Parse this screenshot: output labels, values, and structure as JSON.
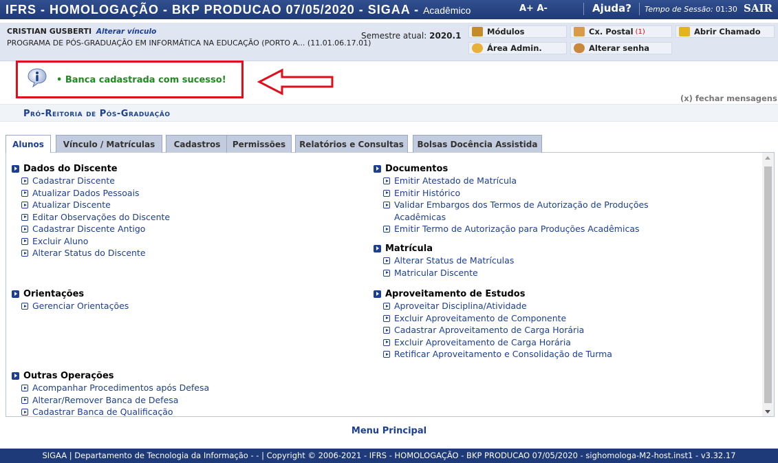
{
  "header": {
    "system_title": "IFRS - HOMOLOGAÇÃO - BKP PRODUCAO 07/05/2020 - SIGAA -",
    "module": "Acadêmico",
    "font_controls": "A+ A-",
    "help": "Ajuda?",
    "session_label": "Tempo de Sessão:",
    "session_time": "01:30",
    "logout": "SAIR"
  },
  "user": {
    "name": "CRISTIAN GUSBERTI",
    "change_link": "Alterar vínculo",
    "program": "PROGRAMA DE PÓS-GRADUAÇÃO EM INFORMÁTICA NA EDUCAÇÃO (PORTO A... (11.01.06.17.01)",
    "semester_label": "Semestre atual:",
    "semester": "2020.1"
  },
  "quick_links": {
    "modules": "Módulos",
    "postal": "Cx. Postal",
    "postal_count": "(1)",
    "ticket": "Abrir Chamado",
    "admin": "Área Admin.",
    "password": "Alterar senha"
  },
  "message": {
    "text": "• Banca cadastrada com sucesso!",
    "close": "(x) fechar mensagens"
  },
  "section_title": "Pró-Reitoria de Pós-Graduação",
  "tabs": [
    "Alunos",
    "Vínculo / Matrículas",
    "Cadastros",
    "Permissões",
    "Relatórios e Consultas",
    "Bolsas Docência Assistida"
  ],
  "groups": {
    "dados": {
      "title": "Dados do Discente",
      "items": [
        "Cadastrar Discente",
        "Atualizar Dados Pessoais",
        "Atualizar Discente",
        "Editar Observações do Discente",
        "Cadastrar Discente Antigo",
        "Excluir Aluno",
        "Alterar Status do Discente"
      ]
    },
    "orientacoes": {
      "title": "Orientações",
      "items": [
        "Gerenciar Orientações"
      ]
    },
    "outras": {
      "title": "Outras Operações",
      "items": [
        "Acompanhar Procedimentos após Defesa",
        "Alterar/Remover Banca de Defesa",
        "Cadastrar Banca de Qualificação"
      ]
    },
    "documentos": {
      "title": "Documentos",
      "items": [
        "Emitir Atestado de Matrícula",
        "Emitir Histórico",
        "Validar Embargos dos Termos de Autorização de Produções Acadêmicas",
        "Emitir Termo de Autorização para Produções Acadêmicas"
      ]
    },
    "matricula": {
      "title": "Matrícula",
      "items": [
        "Alterar Status de Matrículas",
        "Matricular Discente"
      ]
    },
    "aproveitamento": {
      "title": "Aproveitamento de Estudos",
      "items": [
        "Aproveitar Disciplina/Atividade",
        "Excluir Aproveitamento de Componente",
        "Cadastrar Aproveitamento de Carga Horária",
        "Excluir Aproveitamento de Carga Horária",
        "Retificar Aproveitamento e Consolidação de Turma"
      ]
    }
  },
  "main_menu": "Menu Principal",
  "footer": "SIGAA | Departamento de Tecnologia da Informação - - | Copyright © 2006-2021 - IFRS - HOMOLOGAÇÃO - BKP PRODUCAO 07/05/2020 - sighomologa-M2-host.inst1 - v3.32.17"
}
